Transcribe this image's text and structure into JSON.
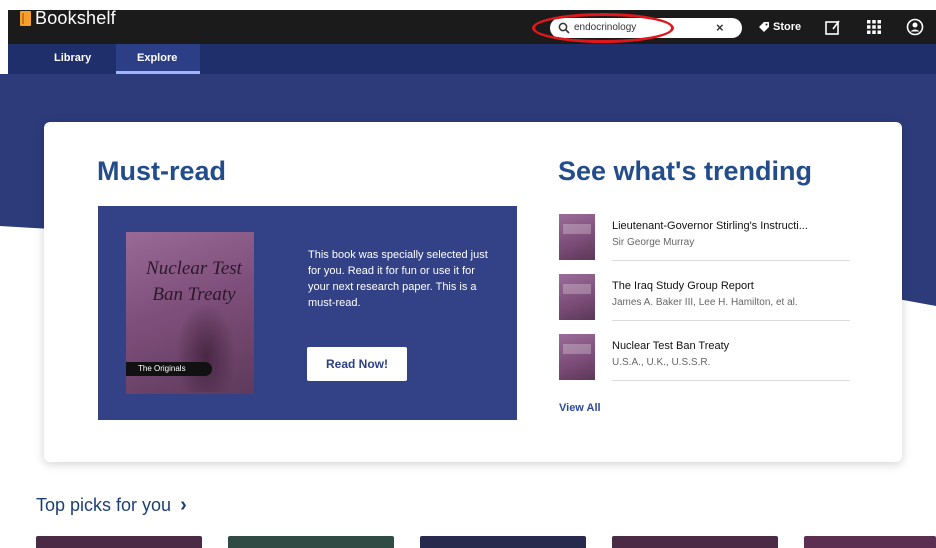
{
  "app": {
    "name": "Bookshelf"
  },
  "search": {
    "query": "endocrinology",
    "clear_symbol": "×"
  },
  "header": {
    "store_label": "Store"
  },
  "nav": {
    "tabs": [
      {
        "label": "Library"
      },
      {
        "label": "Explore",
        "active": true
      }
    ]
  },
  "must_read": {
    "title": "Must-read",
    "book": {
      "title": "Nuclear Test Ban Treaty",
      "series_badge": "The Originals"
    },
    "description": "This book was specially selected just for you. Read it for fun or use it for your next research paper. This is a must-read.",
    "button_label": "Read Now!"
  },
  "trending": {
    "title": "See what's trending",
    "items": [
      {
        "title": "Lieutenant-Governor Stirling's Instructi...",
        "author": "Sir George Murray"
      },
      {
        "title": "The Iraq Study Group Report",
        "author": "James A. Baker III, Lee H. Hamilton, et al."
      },
      {
        "title": "Nuclear Test Ban Treaty",
        "author": "U.S.A., U.K., U.S.S.R."
      }
    ],
    "view_all_label": "View All"
  },
  "top_picks": {
    "title": "Top picks for you",
    "chevron": "›"
  },
  "colors": {
    "top_bar": "#1b1b1b",
    "nav_bar": "#1f2f6b",
    "hero_background": "#2d3b7b",
    "feature_panel": "#334287",
    "heading_blue": "#234c8c",
    "annotation_red": "#e0181c",
    "top_picks_tiles": [
      "#4a2a45",
      "#2f4b44",
      "#27294d",
      "#4a2a45",
      "#5a2f52"
    ]
  },
  "icons": [
    "book-logo-icon",
    "search-icon",
    "clear-icon",
    "tag-icon",
    "notes-icon",
    "apps-grid-icon",
    "account-icon",
    "chevron-right-icon"
  ]
}
